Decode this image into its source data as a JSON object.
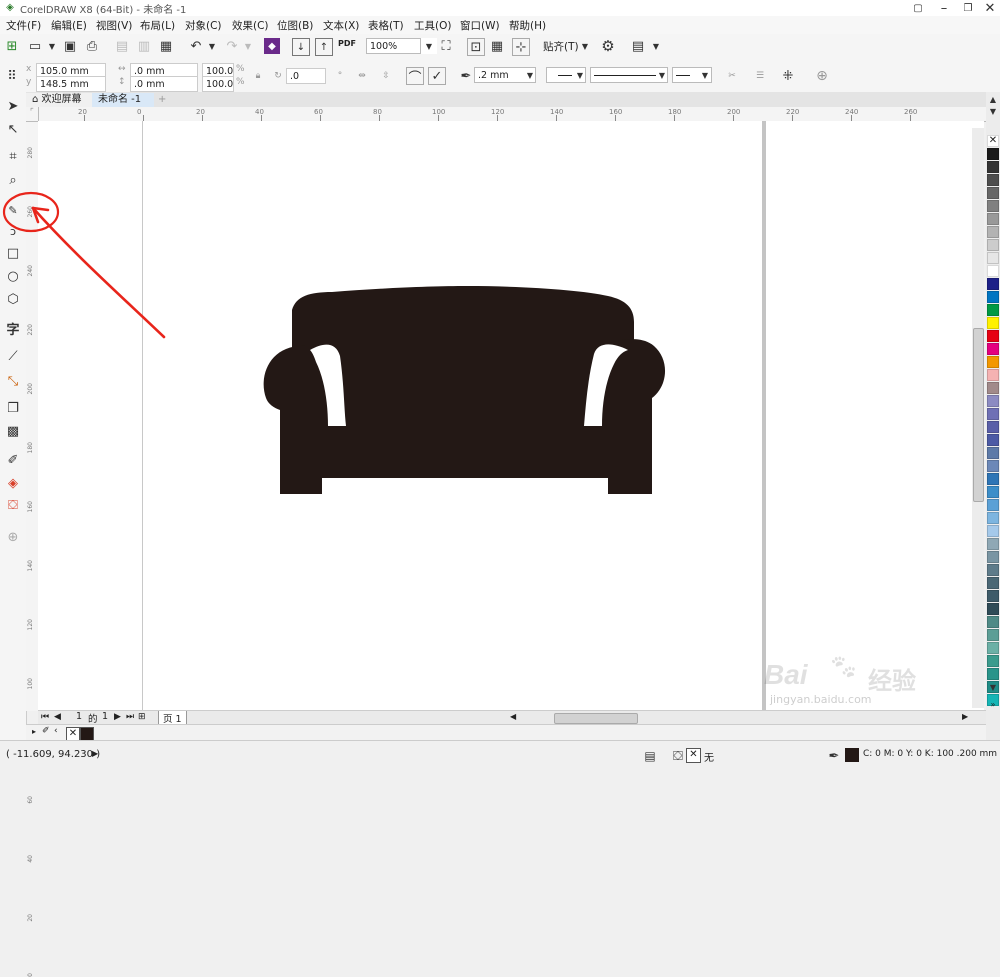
{
  "window": {
    "title": "CorelDRAW X8 (64-Bit) - 未命名 -1"
  },
  "menu": [
    "文件(F)",
    "编辑(E)",
    "视图(V)",
    "布局(L)",
    "对象(C)",
    "效果(C)",
    "位图(B)",
    "文本(X)",
    "表格(T)",
    "工具(O)",
    "窗口(W)",
    "帮助(H)"
  ],
  "toolbar": {
    "zoom_value": "100%",
    "snap_label": "贴齐(T)",
    "pdf_label": "PDF"
  },
  "props": {
    "x": "105.0 mm",
    "y": "148.5 mm",
    "width": ".0 mm",
    "height": ".0 mm",
    "scale_w": "100.0",
    "scale_h": "100.0",
    "pct": "%",
    "angle": ".0",
    "outline_width": ".2 mm"
  },
  "tabs": {
    "welcome": "欢迎屏幕",
    "doc": "未命名 -1",
    "add": "+"
  },
  "hruler": {
    "labels": [
      "20",
      "0",
      "20",
      "40",
      "60",
      "80",
      "100",
      "120",
      "140",
      "160",
      "180",
      "200",
      "220",
      "240",
      "260"
    ]
  },
  "vruler": {
    "labels": [
      "280",
      "260",
      "240",
      "220",
      "200",
      "180",
      "160",
      "140",
      "120",
      "100",
      "80",
      "60",
      "40",
      "20",
      "0"
    ]
  },
  "pagenav": {
    "current": "1",
    "of": "的",
    "total": "1",
    "page_tab": "页 1"
  },
  "status": {
    "coords": "( -11.609, 94.230 )",
    "fill_none": "无",
    "color_info": "C: 0 M: 0 Y: 0 K: 100  .200 mm"
  },
  "watermark": {
    "line1": "Bai",
    "line2": "经验",
    "url": "jingyan.baidu.com"
  },
  "colors": {
    "accent_annotation": "#e8251b",
    "sofa": "#231815",
    "palette": [
      "#1a1a1a",
      "#333333",
      "#4d4d4d",
      "#666666",
      "#808080",
      "#999999",
      "#b3b3b3",
      "#cccccc",
      "#e6e6e6",
      "#ffffff",
      "#1d2088",
      "#0075c2",
      "#009944",
      "#fff100",
      "#e60012",
      "#e4007f",
      "#f39800",
      "#f5b2b2",
      "#a18a8a",
      "#8c8bc2",
      "#6f70b5",
      "#5a5fa8",
      "#4c5aa5",
      "#5d7aa8",
      "#6c88b8",
      "#2e75b6",
      "#3c8ec9",
      "#5aa0d6",
      "#7db5e0",
      "#a5c9ea",
      "#8fa8b5",
      "#7a95a3",
      "#5e7b8a",
      "#4a6775",
      "#3e5b69",
      "#2f4b57",
      "#4f8a86",
      "#5c9e96",
      "#6bb0a6",
      "#3a9b8d",
      "#29948a",
      "#1f8c86",
      "#15b5b5"
    ]
  }
}
